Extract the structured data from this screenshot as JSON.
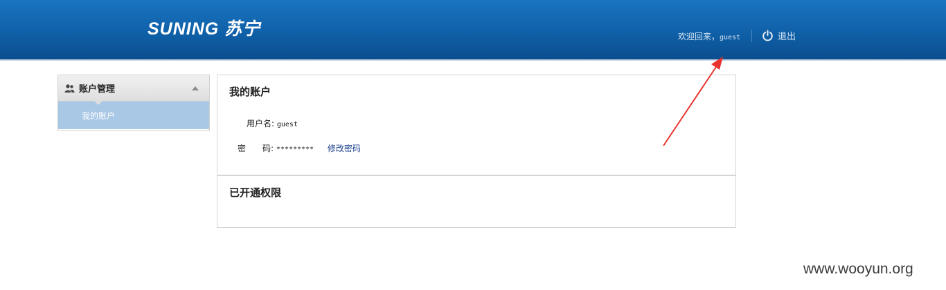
{
  "header": {
    "logo": "SUNING 苏宁",
    "welcome_prefix": "欢迎回来，",
    "username": "guest",
    "logout_label": "退出"
  },
  "sidebar": {
    "section_title": "账户管理",
    "items": [
      {
        "label": "我的账户",
        "active": true
      }
    ]
  },
  "account_panel": {
    "title": "我的账户",
    "username_label": "用户名:",
    "username_value": "guest",
    "password_label_1": "密",
    "password_label_2": "码:",
    "password_value": "*********",
    "change_password_link": "修改密码"
  },
  "permissions_panel": {
    "title": "已开通权限"
  },
  "watermark": "www.wooyun.org",
  "colors": {
    "header_bg": "#0f60a8",
    "sidebar_active": "#a9c8e6",
    "annotation_arrow": "#e8332e",
    "link": "#1a3f8c"
  }
}
